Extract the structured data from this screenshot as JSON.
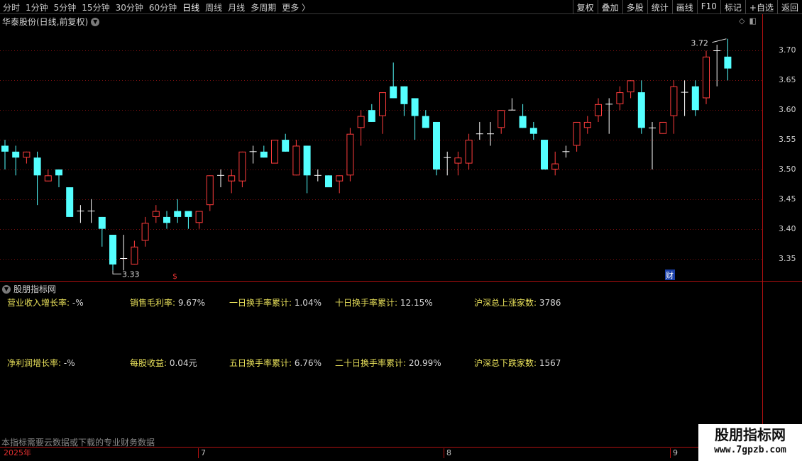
{
  "toolbar": {
    "periods": [
      "分时",
      "1分钟",
      "5分钟",
      "15分钟",
      "30分钟",
      "60分钟",
      "日线",
      "周线",
      "月线",
      "多周期",
      "更多 〉"
    ],
    "active_period": "日线",
    "tools": [
      "复权",
      "叠加",
      "多股",
      "统计",
      "画线",
      "F10",
      "标记",
      "+自选",
      "返回"
    ]
  },
  "main": {
    "title": "华泰股份(日线,前复权)",
    "price_labels": [
      "3.70",
      "3.65",
      "3.60",
      "3.55",
      "3.50",
      "3.45",
      "3.40",
      "3.35"
    ],
    "high_marker": "3.72",
    "low_marker": "3.33",
    "event_marker_s": "$",
    "event_marker_cai": "财"
  },
  "indicator": {
    "title": "股朋指标网",
    "row1": [
      {
        "label": "营业收入增长率:",
        "value": "-%"
      },
      {
        "label": "销售毛利率:",
        "value": "9.67%"
      },
      {
        "label": "一日换手率累计:",
        "value": "1.04%"
      },
      {
        "label": "十日换手率累计:",
        "value": "12.15%"
      },
      {
        "label": "沪深总上涨家数:",
        "value": "3786"
      }
    ],
    "row2": [
      {
        "label": "净利润增长率:",
        "value": "-%"
      },
      {
        "label": "每股收益:",
        "value": "0.04元"
      },
      {
        "label": "五日换手率累计:",
        "value": "6.76%"
      },
      {
        "label": "二十日换手率累计:",
        "value": "20.99%"
      },
      {
        "label": "沪深总下跌家数:",
        "value": "1567"
      }
    ]
  },
  "footer": {
    "note": "本指标需要云数据或下载的专业财务数据",
    "time_ticks": [
      "2025年",
      "7",
      "8",
      "9"
    ]
  },
  "watermark": {
    "name": "股朋指标网",
    "url": "www.7gpzb.com"
  },
  "colors": {
    "background": "#000000",
    "up": "#ff3c3c",
    "down": "#54ffff",
    "doji": "#ffffff",
    "grid": "#7a1010",
    "label_yellow": "#e8e05a"
  },
  "chart_data": {
    "type": "candlestick",
    "ylim": [
      3.31,
      3.74
    ],
    "candles": [
      {
        "o": 3.54,
        "h": 3.55,
        "l": 3.5,
        "c": 3.53
      },
      {
        "o": 3.53,
        "h": 3.54,
        "l": 3.49,
        "c": 3.52
      },
      {
        "o": 3.52,
        "h": 3.53,
        "l": 3.51,
        "c": 3.53
      },
      {
        "o": 3.52,
        "h": 3.53,
        "l": 3.44,
        "c": 3.49
      },
      {
        "o": 3.48,
        "h": 3.5,
        "l": 3.48,
        "c": 3.49
      },
      {
        "o": 3.5,
        "h": 3.5,
        "l": 3.47,
        "c": 3.49
      },
      {
        "o": 3.47,
        "h": 3.47,
        "l": 3.42,
        "c": 3.42
      },
      {
        "o": 3.43,
        "h": 3.44,
        "l": 3.41,
        "c": 3.43
      },
      {
        "o": 3.43,
        "h": 3.45,
        "l": 3.41,
        "c": 3.43
      },
      {
        "o": 3.42,
        "h": 3.42,
        "l": 3.37,
        "c": 3.4
      },
      {
        "o": 3.39,
        "h": 3.39,
        "l": 3.33,
        "c": 3.34
      },
      {
        "o": 3.35,
        "h": 3.39,
        "l": 3.33,
        "c": 3.35
      },
      {
        "o": 3.34,
        "h": 3.38,
        "l": 3.34,
        "c": 3.37
      },
      {
        "o": 3.38,
        "h": 3.42,
        "l": 3.37,
        "c": 3.41
      },
      {
        "o": 3.42,
        "h": 3.44,
        "l": 3.41,
        "c": 3.43
      },
      {
        "o": 3.42,
        "h": 3.43,
        "l": 3.4,
        "c": 3.41
      },
      {
        "o": 3.43,
        "h": 3.45,
        "l": 3.41,
        "c": 3.42
      },
      {
        "o": 3.43,
        "h": 3.43,
        "l": 3.4,
        "c": 3.42
      },
      {
        "o": 3.41,
        "h": 3.43,
        "l": 3.4,
        "c": 3.43
      },
      {
        "o": 3.44,
        "h": 3.49,
        "l": 3.43,
        "c": 3.49
      },
      {
        "o": 3.49,
        "h": 3.5,
        "l": 3.47,
        "c": 3.49
      },
      {
        "o": 3.48,
        "h": 3.5,
        "l": 3.46,
        "c": 3.49
      },
      {
        "o": 3.48,
        "h": 3.53,
        "l": 3.47,
        "c": 3.53
      },
      {
        "o": 3.53,
        "h": 3.54,
        "l": 3.51,
        "c": 3.53
      },
      {
        "o": 3.53,
        "h": 3.54,
        "l": 3.52,
        "c": 3.52
      },
      {
        "o": 3.51,
        "h": 3.55,
        "l": 3.51,
        "c": 3.55
      },
      {
        "o": 3.55,
        "h": 3.56,
        "l": 3.53,
        "c": 3.53
      },
      {
        "o": 3.49,
        "h": 3.55,
        "l": 3.49,
        "c": 3.54
      },
      {
        "o": 3.54,
        "h": 3.54,
        "l": 3.46,
        "c": 3.49
      },
      {
        "o": 3.49,
        "h": 3.5,
        "l": 3.48,
        "c": 3.49
      },
      {
        "o": 3.49,
        "h": 3.49,
        "l": 3.47,
        "c": 3.47
      },
      {
        "o": 3.48,
        "h": 3.49,
        "l": 3.46,
        "c": 3.49
      },
      {
        "o": 3.49,
        "h": 3.57,
        "l": 3.48,
        "c": 3.56
      },
      {
        "o": 3.57,
        "h": 3.6,
        "l": 3.54,
        "c": 3.59
      },
      {
        "o": 3.6,
        "h": 3.61,
        "l": 3.58,
        "c": 3.58
      },
      {
        "o": 3.59,
        "h": 3.63,
        "l": 3.56,
        "c": 3.63
      },
      {
        "o": 3.64,
        "h": 3.68,
        "l": 3.62,
        "c": 3.62
      },
      {
        "o": 3.64,
        "h": 3.64,
        "l": 3.59,
        "c": 3.61
      },
      {
        "o": 3.62,
        "h": 3.62,
        "l": 3.55,
        "c": 3.59
      },
      {
        "o": 3.59,
        "h": 3.6,
        "l": 3.57,
        "c": 3.57
      },
      {
        "o": 3.58,
        "h": 3.58,
        "l": 3.49,
        "c": 3.5
      },
      {
        "o": 3.52,
        "h": 3.53,
        "l": 3.49,
        "c": 3.52
      },
      {
        "o": 3.51,
        "h": 3.53,
        "l": 3.49,
        "c": 3.52
      },
      {
        "o": 3.51,
        "h": 3.56,
        "l": 3.5,
        "c": 3.55
      },
      {
        "o": 3.56,
        "h": 3.58,
        "l": 3.55,
        "c": 3.56
      },
      {
        "o": 3.56,
        "h": 3.58,
        "l": 3.54,
        "c": 3.56
      },
      {
        "o": 3.57,
        "h": 3.6,
        "l": 3.56,
        "c": 3.6
      },
      {
        "o": 3.6,
        "h": 3.62,
        "l": 3.6,
        "c": 3.6
      },
      {
        "o": 3.59,
        "h": 3.61,
        "l": 3.57,
        "c": 3.57
      },
      {
        "o": 3.57,
        "h": 3.58,
        "l": 3.55,
        "c": 3.56
      },
      {
        "o": 3.55,
        "h": 3.55,
        "l": 3.5,
        "c": 3.5
      },
      {
        "o": 3.5,
        "h": 3.53,
        "l": 3.49,
        "c": 3.51
      },
      {
        "o": 3.53,
        "h": 3.54,
        "l": 3.52,
        "c": 3.53
      },
      {
        "o": 3.54,
        "h": 3.58,
        "l": 3.53,
        "c": 3.58
      },
      {
        "o": 3.57,
        "h": 3.59,
        "l": 3.56,
        "c": 3.58
      },
      {
        "o": 3.59,
        "h": 3.62,
        "l": 3.58,
        "c": 3.61
      },
      {
        "o": 3.61,
        "h": 3.62,
        "l": 3.56,
        "c": 3.61
      },
      {
        "o": 3.61,
        "h": 3.64,
        "l": 3.6,
        "c": 3.63
      },
      {
        "o": 3.63,
        "h": 3.65,
        "l": 3.62,
        "c": 3.65
      },
      {
        "o": 3.63,
        "h": 3.65,
        "l": 3.56,
        "c": 3.57
      },
      {
        "o": 3.57,
        "h": 3.58,
        "l": 3.5,
        "c": 3.57
      },
      {
        "o": 3.56,
        "h": 3.58,
        "l": 3.56,
        "c": 3.58
      },
      {
        "o": 3.59,
        "h": 3.65,
        "l": 3.56,
        "c": 3.64
      },
      {
        "o": 3.63,
        "h": 3.65,
        "l": 3.59,
        "c": 3.63
      },
      {
        "o": 3.64,
        "h": 3.65,
        "l": 3.59,
        "c": 3.6
      },
      {
        "o": 3.62,
        "h": 3.7,
        "l": 3.61,
        "c": 3.69
      },
      {
        "o": 3.7,
        "h": 3.71,
        "l": 3.64,
        "c": 3.7
      },
      {
        "o": 3.69,
        "h": 3.72,
        "l": 3.65,
        "c": 3.67
      }
    ]
  }
}
